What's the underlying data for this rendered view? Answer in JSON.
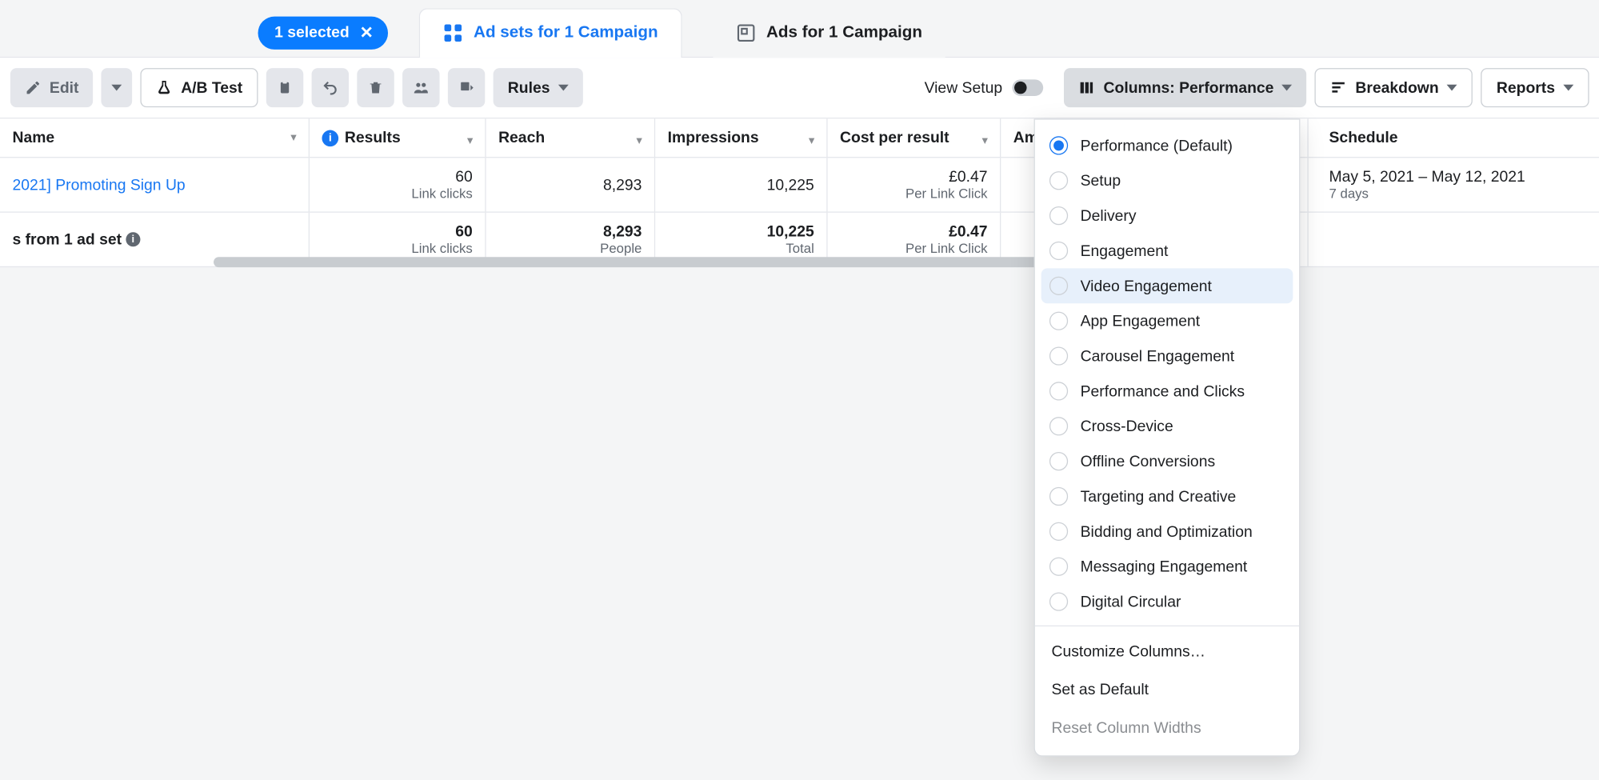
{
  "chip": {
    "label": "1 selected"
  },
  "tabs": {
    "adsets": "Ad sets for 1 Campaign",
    "ads": "Ads for 1 Campaign"
  },
  "toolbar": {
    "edit": "Edit",
    "abtest": "A/B Test",
    "rules": "Rules",
    "view_setup": "View Setup",
    "columns": "Columns: Performance",
    "breakdown": "Breakdown",
    "reports": "Reports"
  },
  "columns": {
    "name": "Name",
    "results": "Results",
    "reach": "Reach",
    "impressions": "Impressions",
    "cost": "Cost per result",
    "amount": "Am",
    "schedule": "Schedule"
  },
  "row": {
    "name": "2021] Promoting Sign Up",
    "results": "60",
    "results_sub": "Link clicks",
    "reach": "8,293",
    "impressions": "10,225",
    "cost": "£0.47",
    "cost_sub": "Per Link Click",
    "schedule": "May 5, 2021 – May 12, 2021",
    "schedule_sub": "7 days"
  },
  "totals": {
    "name": "s from 1 ad set",
    "results": "60",
    "results_sub": "Link clicks",
    "reach": "8,293",
    "reach_sub": "People",
    "impressions": "10,225",
    "impressions_sub": "Total",
    "cost": "£0.47",
    "cost_sub": "Per Link Click"
  },
  "dropdown": {
    "items": [
      "Performance (Default)",
      "Setup",
      "Delivery",
      "Engagement",
      "Video Engagement",
      "App Engagement",
      "Carousel Engagement",
      "Performance and Clicks",
      "Cross-Device",
      "Offline Conversions",
      "Targeting and Creative",
      "Bidding and Optimization",
      "Messaging Engagement",
      "Digital Circular"
    ],
    "customize": "Customize Columns…",
    "set_default": "Set as Default",
    "reset": "Reset Column Widths"
  }
}
